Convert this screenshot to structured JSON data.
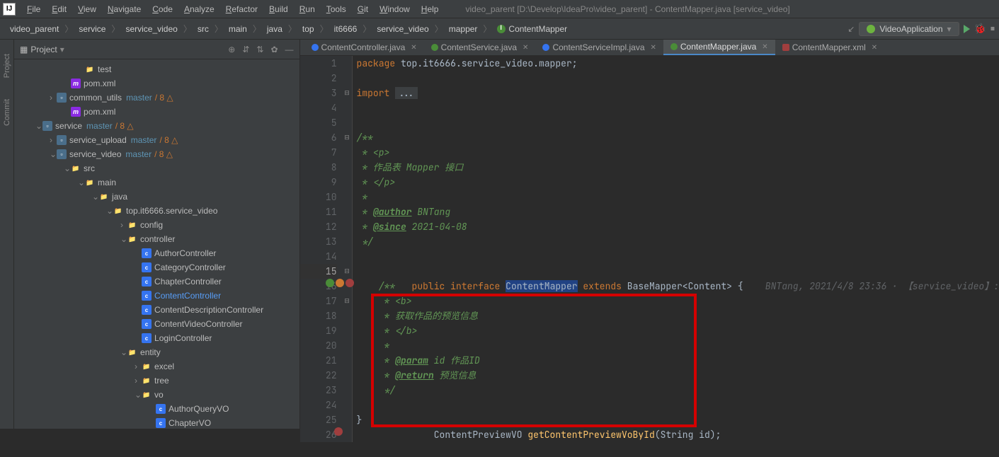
{
  "menubar": {
    "items": [
      "File",
      "Edit",
      "View",
      "Navigate",
      "Code",
      "Analyze",
      "Refactor",
      "Build",
      "Run",
      "Tools",
      "Git",
      "Window",
      "Help"
    ],
    "window_title": "video_parent [D:\\Develop\\IdeaPro\\video_parent] - ContentMapper.java [service_video]"
  },
  "breadcrumbs": [
    "video_parent",
    "service",
    "service_video",
    "src",
    "main",
    "java",
    "top",
    "it6666",
    "service_video",
    "mapper",
    "ContentMapper"
  ],
  "run_config": "VideoApplication",
  "project_panel_title": "Project",
  "tree": [
    {
      "depth": 3,
      "exp": "",
      "icon": "folder",
      "name": "test"
    },
    {
      "depth": 2,
      "exp": "",
      "icon": "m",
      "name": "pom.xml"
    },
    {
      "depth": 1,
      "exp": ">",
      "icon": "module",
      "name": "common_utils",
      "vcs": "master",
      "vcs_ch": "/ 8 △"
    },
    {
      "depth": 2,
      "exp": "",
      "icon": "m",
      "name": "pom.xml"
    },
    {
      "depth": 0,
      "exp": "v",
      "icon": "module",
      "name": "service",
      "vcs": "master",
      "vcs_ch": "/ 8 △"
    },
    {
      "depth": 1,
      "exp": ">",
      "icon": "module",
      "name": "service_upload",
      "vcs": "master",
      "vcs_ch": "/ 8 △"
    },
    {
      "depth": 1,
      "exp": "v",
      "icon": "module",
      "name": "service_video",
      "vcs": "master",
      "vcs_ch": "/ 8 △"
    },
    {
      "depth": 2,
      "exp": "v",
      "icon": "folder",
      "name": "src"
    },
    {
      "depth": 3,
      "exp": "v",
      "icon": "folder",
      "name": "main"
    },
    {
      "depth": 4,
      "exp": "v",
      "icon": "folder",
      "name": "java"
    },
    {
      "depth": 5,
      "exp": "v",
      "icon": "folder",
      "name": "top.it6666.service_video"
    },
    {
      "depth": 6,
      "exp": ">",
      "icon": "folder",
      "name": "config"
    },
    {
      "depth": 6,
      "exp": "v",
      "icon": "folder",
      "name": "controller"
    },
    {
      "depth": 7,
      "exp": "",
      "icon": "class-c",
      "name": "AuthorController"
    },
    {
      "depth": 7,
      "exp": "",
      "icon": "class-c",
      "name": "CategoryController"
    },
    {
      "depth": 7,
      "exp": "",
      "icon": "class-c",
      "name": "ChapterController"
    },
    {
      "depth": 7,
      "exp": "",
      "icon": "class-c",
      "name": "ContentController",
      "hl": true
    },
    {
      "depth": 7,
      "exp": "",
      "icon": "class-c",
      "name": "ContentDescriptionController"
    },
    {
      "depth": 7,
      "exp": "",
      "icon": "class-c",
      "name": "ContentVideoController"
    },
    {
      "depth": 7,
      "exp": "",
      "icon": "class-c",
      "name": "LoginController"
    },
    {
      "depth": 6,
      "exp": "v",
      "icon": "folder",
      "name": "entity"
    },
    {
      "depth": 7,
      "exp": ">",
      "icon": "folder",
      "name": "excel"
    },
    {
      "depth": 7,
      "exp": ">",
      "icon": "folder",
      "name": "tree"
    },
    {
      "depth": 7,
      "exp": "v",
      "icon": "folder",
      "name": "vo"
    },
    {
      "depth": 8,
      "exp": "",
      "icon": "class-c",
      "name": "AuthorQueryVO"
    },
    {
      "depth": 8,
      "exp": "",
      "icon": "class-c",
      "name": "ChapterVO"
    }
  ],
  "tabs": [
    {
      "icon": "c",
      "name": "ContentController.java",
      "active": false
    },
    {
      "icon": "i",
      "name": "ContentService.java",
      "active": false
    },
    {
      "icon": "c",
      "name": "ContentServiceImpl.java",
      "active": false
    },
    {
      "icon": "i",
      "name": "ContentMapper.java",
      "active": true
    },
    {
      "icon": "xml",
      "name": "ContentMapper.xml",
      "active": false
    }
  ],
  "line_numbers_start": 1,
  "line_numbers_end": 26,
  "code": {
    "l1_kw": "package ",
    "l1_rest": "top.it6666.service_video.mapper;",
    "l3_kw": "import ",
    "l3_rest": "...",
    "l5": "/**",
    "l6": " * <p>",
    "l7": " * 作品表 Mapper 接口",
    "l8": " * </p>",
    "l9": " *",
    "l10_a": " * ",
    "l10_tag": "@author",
    "l10_b": " BNTang",
    "l11_a": " * ",
    "l11_tag": "@since",
    "l11_b": " 2021-04-08",
    "l12": " */",
    "l13_pub": "public ",
    "l13_int": "interface ",
    "l13_name": "ContentMapper",
    "l13_ext": " extends ",
    "l13_base": "BaseMapper<Content> {",
    "l13_hint": "    BNTang, 2021/4/8 23:36 · 【service_video】:",
    "l15": "    /**",
    "l16": "     * <b>",
    "l17": "     * 获取作品的预览信息",
    "l18": "     * </b>",
    "l19": "     *",
    "l20_a": "     * ",
    "l20_tag": "@param",
    "l20_b": " id 作品ID",
    "l21_a": "     * ",
    "l21_tag": "@return",
    "l21_b": " 预览信息",
    "l22": "     */",
    "l23_type": "    ContentPreviewVO ",
    "l23_method": "getContentPreviewVoById",
    "l23_params": "(String id);",
    "l24": "}"
  }
}
